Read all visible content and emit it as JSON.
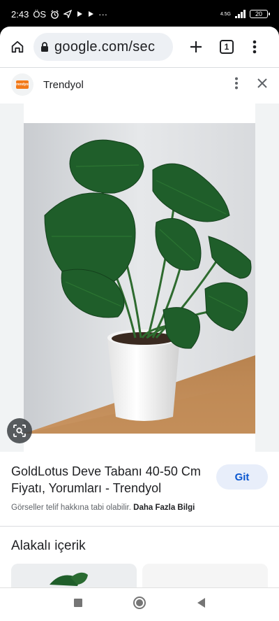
{
  "status_bar": {
    "time": "2:43",
    "carrier": "ÖS",
    "network": "4.5G",
    "battery": "20",
    "dots": "···"
  },
  "toolbar": {
    "url": "google.com/sec",
    "tab_count": "1",
    "icons": [
      "home-icon",
      "lock-icon",
      "plus-icon",
      "tabs-icon",
      "more-vert-icon"
    ]
  },
  "source": {
    "name": "Trendyol",
    "favicon_label": "trendyol"
  },
  "result": {
    "title": "GoldLotus Deve Tabanı 40-50 Cm Fiyatı, Yorumları - Trendyol",
    "visit_label": "Git",
    "copyright_text": "Görseller telif hakkına tabi olabilir.",
    "learn_more": "Daha Fazla Bilgi"
  },
  "related": {
    "title": "Alakalı içerik"
  },
  "colors": {
    "accent": "#0b57d0",
    "visit_bg": "#e8eefa",
    "leaf": "#1f5e2a",
    "brand": "#f27a1a"
  }
}
